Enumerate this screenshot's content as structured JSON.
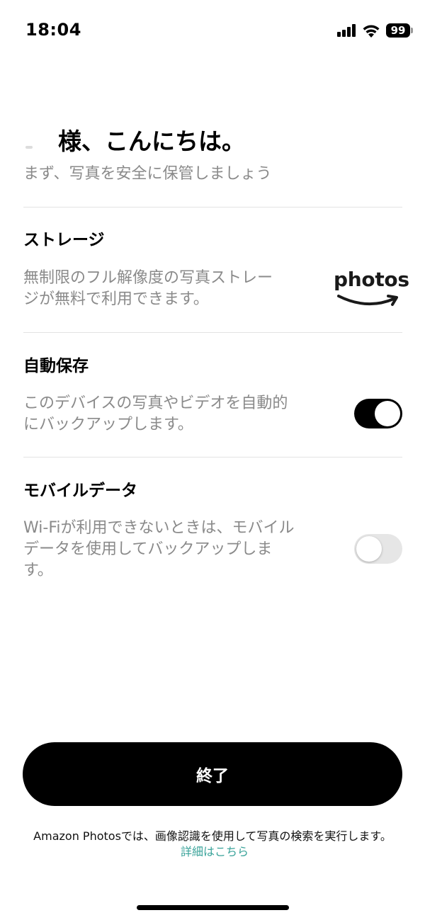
{
  "status_bar": {
    "time": "18:04",
    "battery": "99"
  },
  "greeting": {
    "title": "様、こんにちは。",
    "subtitle": "まず、写真を安全に保管しましょう"
  },
  "storage": {
    "title": "ストレージ",
    "description": "無制限のフル解像度の写真ストレージが無料で利用できます。",
    "logo_text": "photos"
  },
  "auto_save": {
    "title": "自動保存",
    "description": "このデバイスの写真やビデオを自動的にバックアップします。",
    "enabled": true
  },
  "mobile_data": {
    "title": "モバイルデータ",
    "description": "Wi-Fiが利用できないときは、モバイルデータを使用してバックアップします。",
    "enabled": false
  },
  "finish_button": {
    "label": "終了"
  },
  "footer": {
    "note": "Amazon Photosでは、画像認識を使用して写真の検索を実行します。",
    "link": "詳細はこちら"
  },
  "colors": {
    "accent_link": "#3aa39a",
    "toggle_on": "#000000",
    "toggle_off": "#e6e6e6",
    "secondary_text": "#8a8a8a"
  }
}
